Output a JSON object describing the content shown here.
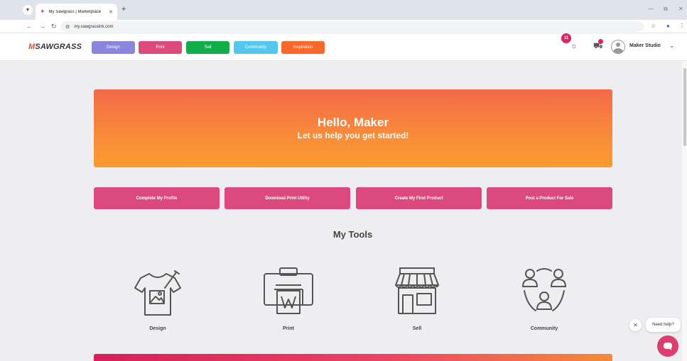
{
  "browser": {
    "tab_title": "My Sawgrass | Marketplace",
    "url": "my.sawgrassink.com"
  },
  "header": {
    "logo_text": "SAWGRASS",
    "nav": [
      {
        "label": "Design",
        "color": "#8b86dc"
      },
      {
        "label": "Print",
        "color": "#dc4a7d"
      },
      {
        "label": "Sell",
        "color": "#12ac4b"
      },
      {
        "label": "Community",
        "color": "#53c7ee"
      },
      {
        "label": "Inspiration",
        "color": "#f6692b"
      }
    ],
    "notification_count": "11",
    "user_name": "Maker Studio"
  },
  "hero": {
    "title": "Hello, Maker",
    "subtitle": "Let us help you get started!"
  },
  "quick_actions": [
    "Complete My Profile",
    "Download Print Utility",
    "Create My First Product",
    "Post a Product For Sale"
  ],
  "tools": {
    "heading": "My Tools",
    "items": [
      {
        "label": "Design",
        "icon": "tshirt-brush-icon"
      },
      {
        "label": "Print",
        "icon": "printer-icon"
      },
      {
        "label": "Sell",
        "icon": "storefront-icon"
      },
      {
        "label": "Community",
        "icon": "people-network-icon"
      }
    ]
  },
  "help": {
    "label": "Need help?"
  }
}
